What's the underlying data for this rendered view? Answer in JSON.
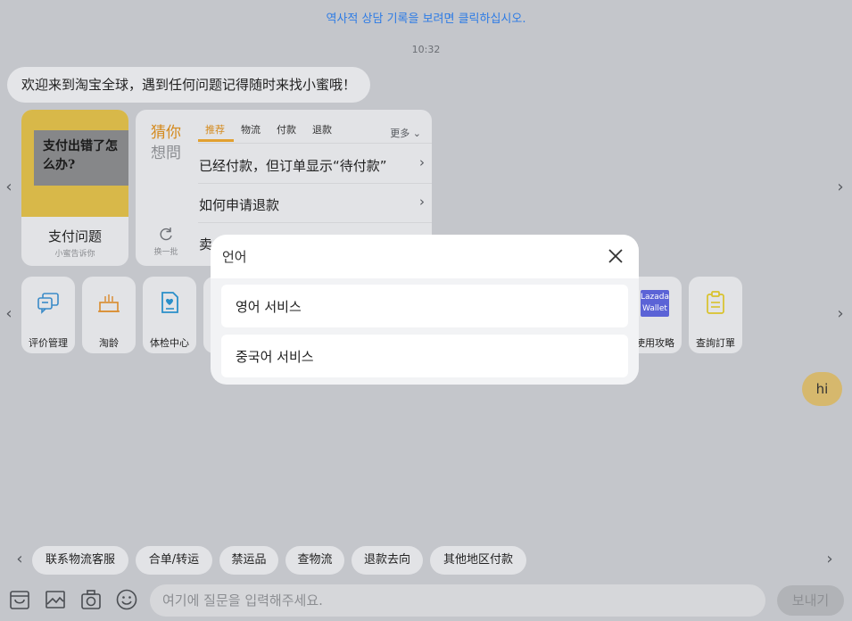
{
  "history": {
    "link_text": "역사적 상담 기록을 보려면 클릭하십시오.",
    "timestamp": "10:32"
  },
  "welcome": {
    "text": "欢迎来到淘宝全球，遇到任何问题记得随时来找小蜜哦！"
  },
  "pay_card": {
    "image_text": "支付出错了怎么办?",
    "title": "支付问题",
    "subtitle": "小蜜告诉你"
  },
  "faq_card": {
    "guess_title": "猜你",
    "guess_sub": "想問",
    "refresh_label": "换一批",
    "tabs": [
      "推荐",
      "物流",
      "付款",
      "退款"
    ],
    "more_label": "更多",
    "items": [
      "已经付款，但订单显示“待付款”",
      "如何申请退款",
      "卖"
    ]
  },
  "tools": [
    {
      "label": "评价管理",
      "icon": "review-icon"
    },
    {
      "label": "淘龄",
      "icon": "cake-icon"
    },
    {
      "label": "体检中心",
      "icon": "checkup-icon"
    },
    {
      "label": "使用攻略",
      "icon": "lazada-wallet-icon",
      "icon_text": "Lazada Wallet"
    },
    {
      "label": "查詢訂單",
      "icon": "clipboard-icon"
    }
  ],
  "user_message": {
    "text": "hi"
  },
  "quick_replies": [
    "联系物流客服",
    "合单/转运",
    "禁运品",
    "查物流",
    "退款去向",
    "其他地区付款"
  ],
  "composer": {
    "placeholder": "여기에 질문을 입력해주세요.",
    "send_label": "보내기"
  },
  "language_modal": {
    "title": "언어",
    "options": [
      "영어 서비스",
      "중국어 서비스"
    ]
  },
  "colors": {
    "accent": "#d48a1d",
    "link": "#2d7be5",
    "user_bubble": "#d6b86d",
    "background": "#c4c6cb"
  }
}
